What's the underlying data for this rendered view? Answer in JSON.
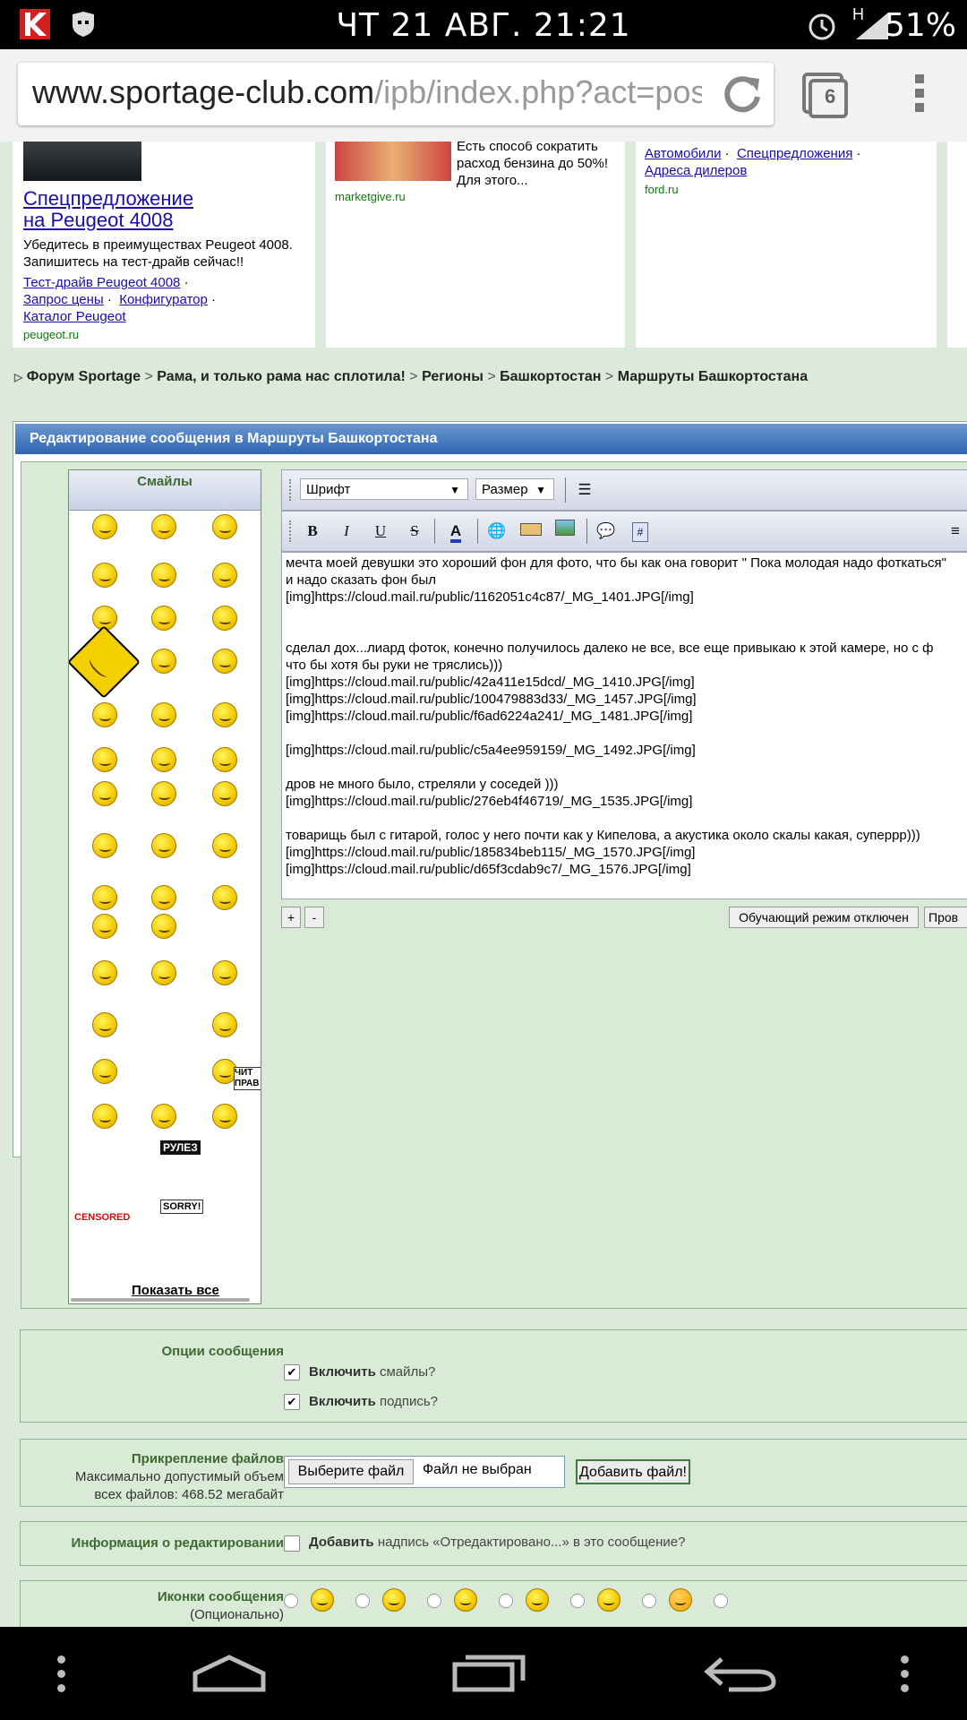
{
  "status_bar": {
    "time": "ЧТ 21 АВГ. 21:21",
    "battery": "51%",
    "network": "H"
  },
  "browser": {
    "url_domain": "www.sportage-club.com",
    "url_path": "/ipb/index.php?act=post&c",
    "tab_count": "6"
  },
  "ads": [
    {
      "title": "Спецпредложение на Peugeot 4008",
      "title_line1": "Спецпредложение",
      "title_line2": "на Peugeot 4008",
      "text": "Убедитесь в преимуществах Peugeot 4008. Запишитесь на тест-драйв сейчас!!",
      "links": [
        "Тест-драйв Peugeot 4008",
        "Запрос цены",
        "Конфигуратор",
        "Каталог Peugeot"
      ],
      "source": "peugeot.ru"
    },
    {
      "text": "Есть способ сократить расход бензина до 50%! Для этого...",
      "source": "marketgive.ru"
    },
    {
      "links": [
        "Автомобили",
        "Спецпредложения",
        "Адреса дилеров"
      ],
      "source": "ford.ru"
    }
  ],
  "breadcrumb": [
    "Форум Sportage",
    "Рама, и только рама нас сплотила!",
    "Регионы",
    "Башкортостан",
    "Маршруты Башкортостана"
  ],
  "breadcrumb_sep": ">",
  "form_title": "Редактирование сообщения в Маршруты Башкортостана",
  "smiles_panel": {
    "title": "Смайлы",
    "show_all": "Показать все",
    "sign_rulez": "РУЛЕЗ",
    "sign_sorry": "SORRY!",
    "sign_censored": "CENSORED",
    "sign_chit": "ЧИТ ПРАВ"
  },
  "editor": {
    "font_select": "Шрифт",
    "size_select": "Размер",
    "bold": "B",
    "italic": "I",
    "underline": "U",
    "strike": "S",
    "text_lines": [
      "мечта моей девушки это хороший фон для фото, что бы как она говорит \" Пока молодая надо фоткаться\"",
      "и надо сказать фон был",
      "[img]https://cloud.mail.ru/public/1162051c4c87/_MG_1401.JPG[/img]",
      "",
      "",
      "сделал дох...лиард фоток, конечно получилось далеко не все, все еще привыкаю к этой камере, но с ф",
      "что бы хотя бы руки не тряслись)))",
      "[img]https://cloud.mail.ru/public/42a411e15dcd/_MG_1410.JPG[/img]",
      "[img]https://cloud.mail.ru/public/100479883d33/_MG_1457.JPG[/img]",
      "[img]https://cloud.mail.ru/public/f6ad6224a241/_MG_1481.JPG[/img]",
      "",
      "[img]https://cloud.mail.ru/public/c5a4ee959159/_MG_1492.JPG[/img]",
      "",
      "дров не много было, стреляли у соседей )))",
      "[img]https://cloud.mail.ru/public/276eb4f46719/_MG_1535.JPG[/img]",
      "",
      "товарищь был с гитарой, голос у него почти как у Кипелова, а акустика около скалы какая, суперрр)))",
      "[img]https://cloud.mail.ru/public/185834beb115/_MG_1570.JPG[/img]",
      "[img]https://cloud.mail.ru/public/d65f3cdab9c7/_MG_1576.JPG[/img]"
    ],
    "plus_btn": "+",
    "minus_btn": "-",
    "training_mode_btn": "Обучающий режим отключен",
    "preview_btn": "Пров"
  },
  "options": {
    "label": "Опции сообщения",
    "enable_smiles_bold": "Включить",
    "enable_smiles_rest": " смайлы?",
    "enable_sig_bold": "Включить",
    "enable_sig_rest": " подпись?",
    "smiles_checked": true,
    "sig_checked": true
  },
  "attachments": {
    "label": "Прикрепление файлов",
    "max_line1": "Максимально допустимый объем",
    "max_line2": "всех файлов: 468.52 мегабайт",
    "choose_btn": "Выберите файл",
    "no_file": "Файл не выбран",
    "add_btn": "Добавить файл!"
  },
  "edit_info": {
    "label": "Информация о редактировании",
    "add_bold": "Добавить",
    "add_rest": " надпись «Отредактировано...» в это сообщение?"
  },
  "message_icons": {
    "label": "Иконки сообщения",
    "sub": "(Опционально)"
  }
}
